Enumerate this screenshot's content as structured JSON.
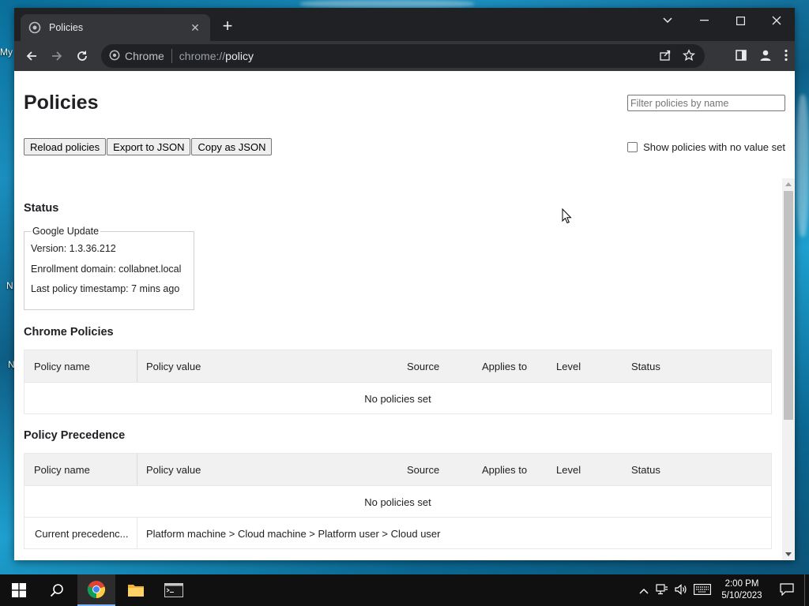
{
  "desktop": {
    "labels": [
      "My",
      "N",
      "N"
    ]
  },
  "browser": {
    "tab_title": "Chrome",
    "active_tab": {
      "title": "Policies"
    },
    "omnibox": {
      "site_label": "Chrome",
      "url_prefix": "chrome://",
      "url_path": "policy"
    }
  },
  "page": {
    "title": "Policies",
    "filter_placeholder": "Filter policies by name",
    "buttons": {
      "reload": "Reload policies",
      "export": "Export to JSON",
      "copy": "Copy as JSON"
    },
    "show_no_value": {
      "label": "Show policies with no value set",
      "checked": false
    },
    "status": {
      "heading": "Status",
      "box_title": "Google Update",
      "version": "Version: 1.3.36.212",
      "enrollment": "Enrollment domain: collabnet.local",
      "timestamp": "Last policy timestamp: 7 mins ago"
    },
    "table_columns": [
      "Policy name",
      "Policy value",
      "Source",
      "Applies to",
      "Level",
      "Status"
    ],
    "chrome_policies": {
      "heading": "Chrome Policies",
      "empty_text": "No policies set"
    },
    "policy_precedence": {
      "heading": "Policy Precedence",
      "empty_text": "No policies set",
      "row_name": "Current precedenc...",
      "row_value": "Platform machine > Cloud machine > Platform user > Cloud user"
    }
  },
  "taskbar": {
    "time": "2:00 PM",
    "date": "5/10/2023"
  },
  "colors": {
    "tab_strip": "#202124",
    "toolbar": "#35363a",
    "table_header": "#f1f1f1",
    "taskbar": "#101010"
  }
}
